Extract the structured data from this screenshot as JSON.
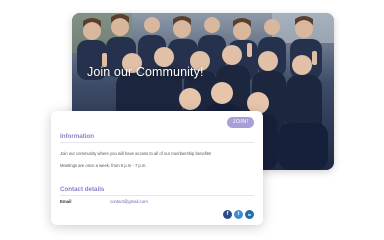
{
  "hero": {
    "title": "Join our Community!"
  },
  "card": {
    "join_label": "JOIN!",
    "information": {
      "heading": "Information",
      "line1": "Join our community where you will have access to all of our membership benefits!",
      "line2": "Meetings are once a week, from 5 p.m - 7 p.m."
    },
    "contact": {
      "heading": "Contact details",
      "email_label": "Email",
      "email_value": "contact@gmail.com"
    },
    "social": [
      {
        "icon": "facebook-icon",
        "glyph": "f",
        "color": "#2d4a8a"
      },
      {
        "icon": "twitter-icon",
        "glyph": "t",
        "color": "#3a8fd0"
      },
      {
        "icon": "linkedin-icon",
        "glyph": "in",
        "color": "#1d6fa8"
      }
    ]
  },
  "colors": {
    "accent": "#a99ed8",
    "heading": "#8c7fcc",
    "link": "#6a5fc0"
  }
}
